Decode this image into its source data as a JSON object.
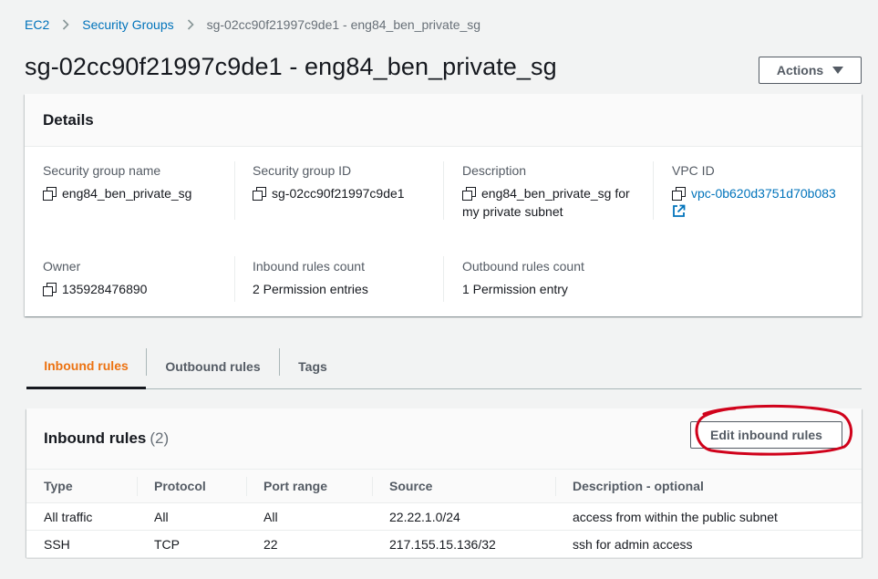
{
  "breadcrumb": {
    "items": [
      "EC2",
      "Security Groups"
    ],
    "current": "sg-02cc90f21997c9de1 - eng84_ben_private_sg"
  },
  "page": {
    "title": "sg-02cc90f21997c9de1 - eng84_ben_private_sg",
    "actions_label": "Actions"
  },
  "details": {
    "title": "Details",
    "sg_name_label": "Security group name",
    "sg_name_value": "eng84_ben_private_sg",
    "sg_id_label": "Security group ID",
    "sg_id_value": "sg-02cc90f21997c9de1",
    "description_label": "Description",
    "description_value": "eng84_ben_private_sg for my private subnet",
    "vpc_label": "VPC ID",
    "vpc_value": "vpc-0b620d3751d70b083",
    "owner_label": "Owner",
    "owner_value": "135928476890",
    "inbound_count_label": "Inbound rules count",
    "inbound_count_value": "2 Permission entries",
    "outbound_count_label": "Outbound rules count",
    "outbound_count_value": "1 Permission entry"
  },
  "tabs": {
    "inbound": "Inbound rules",
    "outbound": "Outbound rules",
    "tags": "Tags"
  },
  "inbound_rules": {
    "title": "Inbound rules",
    "count": "(2)",
    "edit_label": "Edit inbound rules",
    "columns": [
      "Type",
      "Protocol",
      "Port range",
      "Source",
      "Description - optional"
    ],
    "rows": [
      [
        "All traffic",
        "All",
        "All",
        "22.22.1.0/24",
        "access from within the public subnet"
      ],
      [
        "SSH",
        "TCP",
        "22",
        "217.155.15.136/32",
        "ssh for admin access"
      ]
    ]
  },
  "colors": {
    "link": "#0073bb",
    "active_tab": "#ec7211",
    "annotation": "#d0021b"
  }
}
